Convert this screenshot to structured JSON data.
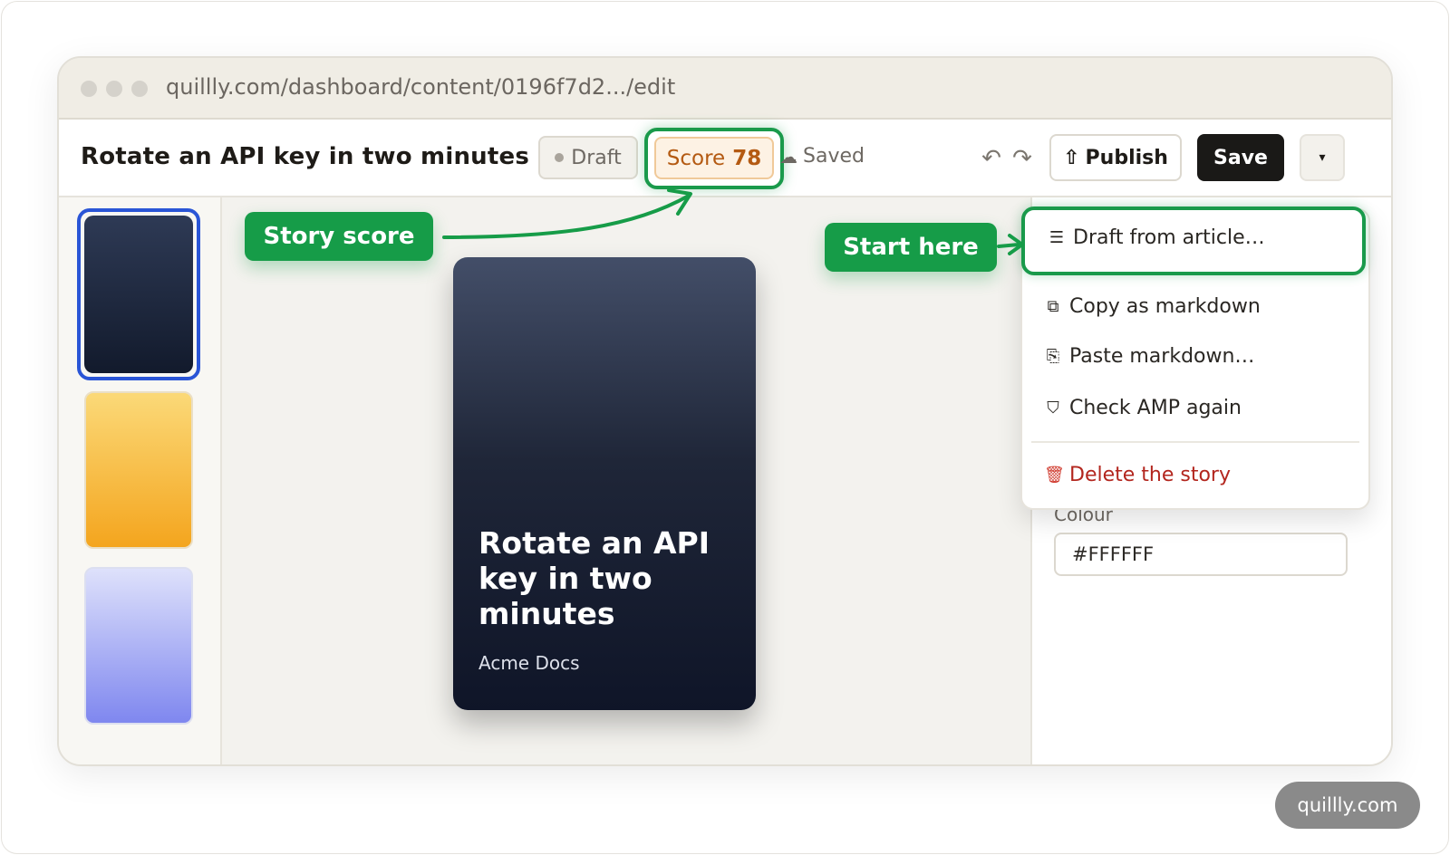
{
  "browser": {
    "url": "quillly.com/dashboard/content/0196f7d2.../edit"
  },
  "toolbar": {
    "story_title": "Rotate an API key in two minutes",
    "status_label": "Draft",
    "score_label": "Score",
    "score_value": "78",
    "saved_label": "Saved",
    "undo_icon": "↶",
    "redo_icon": "↷",
    "publish_icon": "⇧",
    "publish_label": "Publish",
    "save_label": "Save",
    "more_icon": "▾"
  },
  "story_card": {
    "title": "Rotate an API key in two minutes",
    "brand": "Acme Docs"
  },
  "thumbnails": [
    {
      "name": "dark",
      "selected": true
    },
    {
      "name": "amber",
      "selected": false
    },
    {
      "name": "lavender",
      "selected": false
    }
  ],
  "menu": {
    "items": [
      {
        "icon": "☰",
        "label": "Draft from article…"
      },
      {
        "icon": "⧉",
        "label": "Copy as markdown"
      },
      {
        "icon": "⎘",
        "label": "Paste markdown…"
      },
      {
        "icon": "⛉",
        "label": "Check AMP again"
      },
      {
        "icon": "🗑",
        "label": "Delete the story"
      }
    ]
  },
  "settings": {
    "colour_label": "Colour",
    "colour_value": "#FFFFFF"
  },
  "callouts": {
    "score": "Story score",
    "start": "Start here"
  },
  "watermark": "quillly.com",
  "colors": {
    "accent_green": "#169c48",
    "selection_blue": "#2a55d6",
    "score_orange": "#b45a12",
    "danger_red": "#b3261e"
  }
}
